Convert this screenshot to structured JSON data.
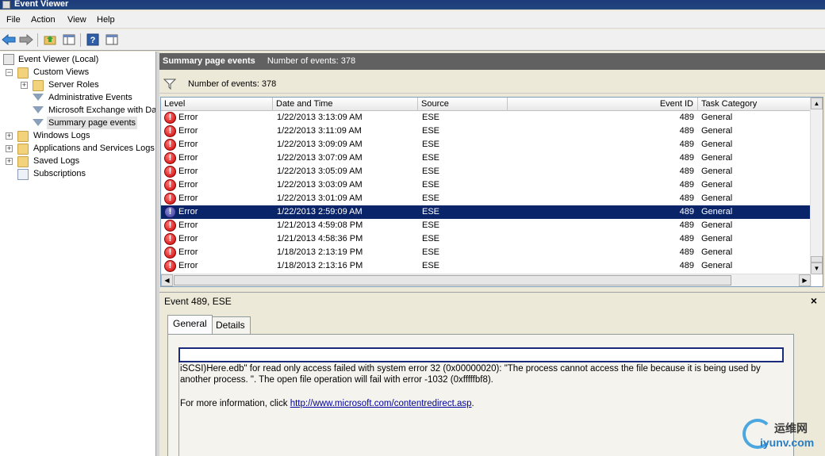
{
  "window": {
    "title": "Event Viewer"
  },
  "menu": [
    "File",
    "Action",
    "View",
    "Help"
  ],
  "tree": {
    "root": "Event Viewer (Local)",
    "custom_views": "Custom Views",
    "server_roles": "Server Roles",
    "admin_events": "Administrative Events",
    "exchange": "Microsoft Exchange with Da",
    "summary": "Summary page events",
    "windows_logs": "Windows Logs",
    "apps_services": "Applications and Services Logs",
    "saved_logs": "Saved Logs",
    "subscriptions": "Subscriptions"
  },
  "header": {
    "title": "Summary page events",
    "count": "Number of events: 378"
  },
  "filter": {
    "label": "Number of events: 378"
  },
  "columns": {
    "level": "Level",
    "datetime": "Date and Time",
    "source": "Source",
    "eventid": "Event ID",
    "category": "Task Category"
  },
  "rows": [
    {
      "level": "Error",
      "datetime": "1/22/2013 3:13:09 AM",
      "source": "ESE",
      "eventid": "489",
      "category": "General"
    },
    {
      "level": "Error",
      "datetime": "1/22/2013 3:11:09 AM",
      "source": "ESE",
      "eventid": "489",
      "category": "General"
    },
    {
      "level": "Error",
      "datetime": "1/22/2013 3:09:09 AM",
      "source": "ESE",
      "eventid": "489",
      "category": "General"
    },
    {
      "level": "Error",
      "datetime": "1/22/2013 3:07:09 AM",
      "source": "ESE",
      "eventid": "489",
      "category": "General"
    },
    {
      "level": "Error",
      "datetime": "1/22/2013 3:05:09 AM",
      "source": "ESE",
      "eventid": "489",
      "category": "General"
    },
    {
      "level": "Error",
      "datetime": "1/22/2013 3:03:09 AM",
      "source": "ESE",
      "eventid": "489",
      "category": "General"
    },
    {
      "level": "Error",
      "datetime": "1/22/2013 3:01:09 AM",
      "source": "ESE",
      "eventid": "489",
      "category": "General"
    },
    {
      "level": "Error",
      "datetime": "1/22/2013 2:59:09 AM",
      "source": "ESE",
      "eventid": "489",
      "category": "General",
      "selected": true
    },
    {
      "level": "Error",
      "datetime": "1/21/2013 4:59:08 PM",
      "source": "ESE",
      "eventid": "489",
      "category": "General"
    },
    {
      "level": "Error",
      "datetime": "1/21/2013 4:58:36 PM",
      "source": "ESE",
      "eventid": "489",
      "category": "General"
    },
    {
      "level": "Error",
      "datetime": "1/18/2013 2:13:19 PM",
      "source": "ESE",
      "eventid": "489",
      "category": "General"
    },
    {
      "level": "Error",
      "datetime": "1/18/2013 2:13:16 PM",
      "source": "ESE",
      "eventid": "489",
      "category": "General"
    }
  ],
  "detail": {
    "title": "Event 489, ESE",
    "close": "×",
    "tab_general": "General",
    "tab_details": "Details",
    "line1": "iSCSI)Here.edb\" for read only access failed with system error 32 (0x00000020): \"The process cannot access the file because it is being used by",
    "line2": "another process. \".  The open file operation will fail with error -1032 (0xfffffbf8).",
    "more_prefix": "For more information, click ",
    "more_link": "http://www.microsoft.com/contentredirect.asp",
    "more_suffix": "."
  },
  "watermark": {
    "line1": "运维网",
    "line2": "iyunv.com"
  },
  "colors": {
    "header_bg": "#616161",
    "selection": "#0a246a",
    "error": "#c80000"
  }
}
